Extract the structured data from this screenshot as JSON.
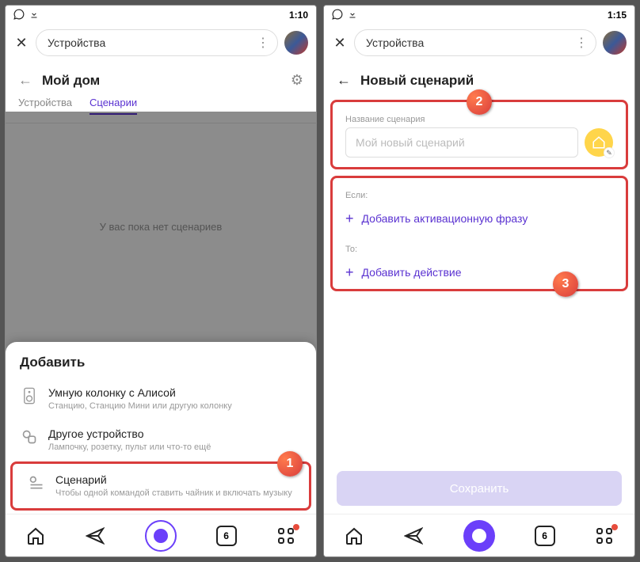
{
  "left": {
    "status_time": "1:10",
    "search_label": "Устройства",
    "page_title": "Мой дом",
    "tabs": {
      "devices": "Устройства",
      "scenarios": "Сценарии"
    },
    "empty_text": "У вас пока нет сценариев",
    "sheet_title": "Добавить",
    "items": [
      {
        "title": "Умную колонку с Алисой",
        "sub": "Станцию, Станцию Мини или другую колонку"
      },
      {
        "title": "Другое устройство",
        "sub": "Лампочку, розетку, пульт или что-то ещё"
      },
      {
        "title": "Сценарий",
        "sub": "Чтобы одной командой ставить чайник и включать музыку"
      }
    ],
    "badge_count": "6"
  },
  "right": {
    "status_time": "1:15",
    "search_label": "Устройства",
    "page_title": "Новый сценарий",
    "name_label": "Название сценария",
    "name_placeholder": "Мой новый сценарий",
    "if_label": "Если:",
    "add_phrase": "Добавить активационную фразу",
    "then_label": "То:",
    "add_action": "Добавить действие",
    "save_label": "Сохранить",
    "badge_count": "6"
  },
  "callouts": {
    "n1": "1",
    "n2": "2",
    "n3": "3"
  }
}
